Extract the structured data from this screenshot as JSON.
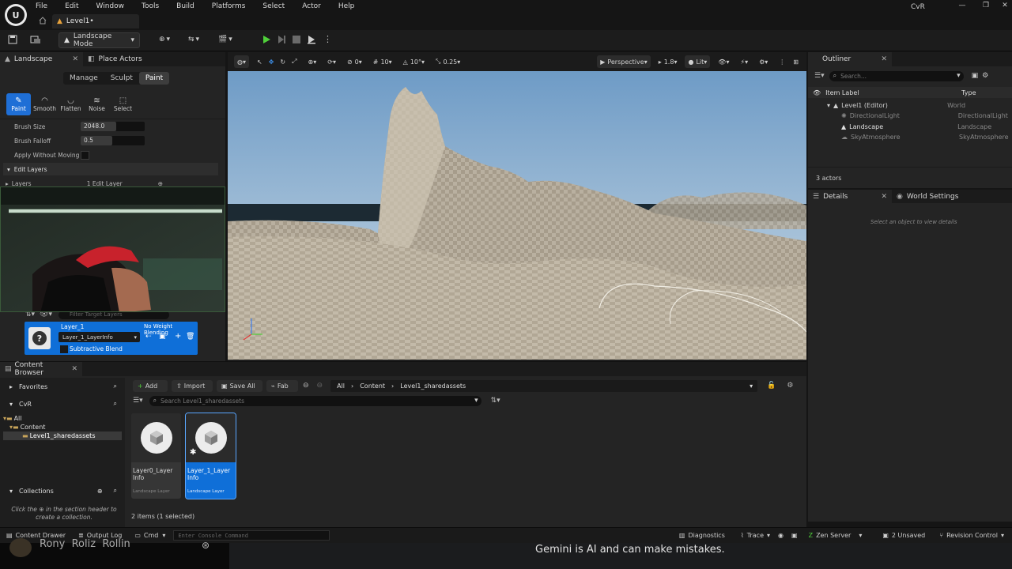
{
  "titlebar": {
    "menus": [
      "File",
      "Edit",
      "Window",
      "Tools",
      "Build",
      "Platforms",
      "Select",
      "Actor",
      "Help"
    ],
    "level_tab": "Level1•",
    "project": "CvR"
  },
  "toolbar": {
    "mode": "Landscape Mode"
  },
  "left_panel": {
    "tab_landscape": "Landscape",
    "tab_place_actors": "Place Actors",
    "modes": [
      "Manage",
      "Sculpt",
      "Paint"
    ],
    "active_mode": "Paint",
    "tools": [
      "Paint",
      "Smooth",
      "Flatten",
      "Noise",
      "Select"
    ],
    "props": {
      "brush_size_label": "Brush Size",
      "brush_size_value": "2048.0",
      "brush_falloff_label": "Brush Falloff",
      "brush_falloff_value": "0.5",
      "apply_label": "Apply Without Moving"
    },
    "edit_layers_header": "Edit Layers",
    "layers_label": "Layers",
    "layers_value": "1 Edit Layer",
    "filter_placeholder": "Filter Target Layers",
    "layer": {
      "name": "Layer_1",
      "blending": "No Weight Blending",
      "info": "Layer_1_LayerInfo",
      "subtractive": "Subtractive Blend"
    }
  },
  "viewport": {
    "angle": "0",
    "grid": "10",
    "rot": "10°",
    "scale": "0.25",
    "perspective": "Perspective",
    "fov": "1.8",
    "lit": "Lit"
  },
  "outliner": {
    "tab": "Outliner",
    "search_placeholder": "Search...",
    "col_label": "Item Label",
    "col_type": "Type",
    "rows": [
      {
        "label": "Level1 (Editor)",
        "type": "World"
      },
      {
        "label": "DirectionalLight",
        "type": "DirectionalLight"
      },
      {
        "label": "Landscape",
        "type": "Landscape"
      },
      {
        "label": "SkyAtmosphere",
        "type": "SkyAtmosphere"
      }
    ],
    "count": "3 actors"
  },
  "details": {
    "tab_details": "Details",
    "tab_world": "World Settings",
    "empty": "Select an object to view details"
  },
  "content_browser": {
    "tab": "Content Browser",
    "favorites": "Favorites",
    "project": "CvR",
    "tree": [
      "All",
      "Content",
      "Level1_sharedassets"
    ],
    "collections": "Collections",
    "collections_hint_1": "Click the",
    "collections_hint_2": "in the section header to",
    "collections_hint_3": "create a collection.",
    "add": "Add",
    "import": "Import",
    "save_all": "Save All",
    "fab": "Fab",
    "path": [
      "All",
      "Content",
      "Level1_sharedassets"
    ],
    "search_placeholder": "Search Level1_sharedassets",
    "assets": [
      {
        "name": "Layer0_Layer Info",
        "type": "Landscape Layer"
      },
      {
        "name": "Layer_1_Layer Info",
        "type": "Landscape Layer"
      }
    ],
    "count": "2 items (1 selected)"
  },
  "statusbar": {
    "content_drawer": "Content Drawer",
    "output_log": "Output Log",
    "cmd": "Cmd",
    "console_placeholder": "Enter Console Command",
    "diagnostics": "Diagnostics",
    "trace": "Trace",
    "zen": "Zen Server",
    "unsaved": "2 Unsaved",
    "revision": "Revision Control"
  },
  "overlay": {
    "gemini": "Gemini is AI and can make mistakes.",
    "names": "Rony  Roliz  Rollin"
  }
}
